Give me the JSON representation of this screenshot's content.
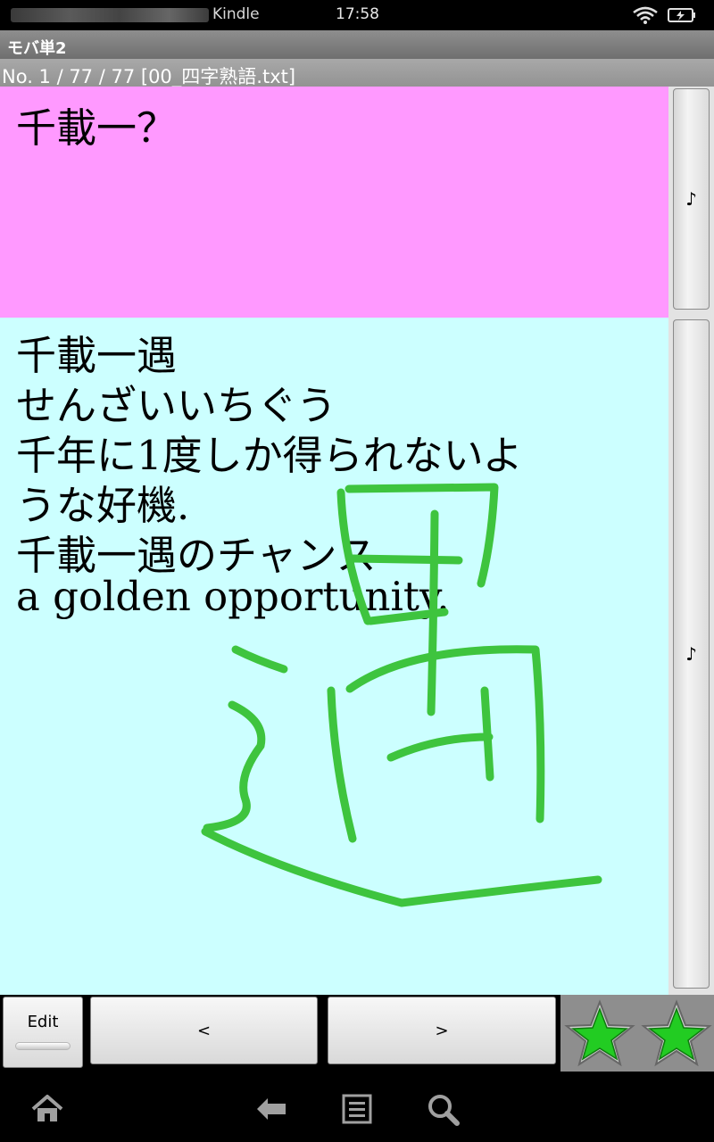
{
  "status_bar": {
    "app_name": "Kindle",
    "time": "17:58"
  },
  "app": {
    "title": "モバ単2",
    "file_info": "No. 1 / 77 / 77 [00_四字熟語.txt]"
  },
  "question": {
    "text": "千載一？"
  },
  "answer": {
    "lines": [
      "千載一遇",
      "せんざいいちぐう",
      "千年に1度しか得られないよ",
      "うな好機.",
      "千載一遇のチャンス",
      "a golden opportunity."
    ]
  },
  "side_buttons": {
    "question_sound": "♪",
    "answer_sound": "♪"
  },
  "controls": {
    "edit_label": "Edit",
    "prev_label": "<",
    "next_label": ">",
    "stars": [
      {
        "icon": "star-icon",
        "color": "#22cc22"
      },
      {
        "icon": "star-icon",
        "color": "#22cc22"
      }
    ]
  },
  "nav_bar": {
    "icons": [
      "home-icon",
      "back-icon",
      "menu-icon",
      "search-icon"
    ]
  },
  "colors": {
    "question_bg": "#ff99ff",
    "answer_bg": "#ccffff",
    "handwriting": "#3ec43e",
    "star_fill": "#22cc22"
  }
}
